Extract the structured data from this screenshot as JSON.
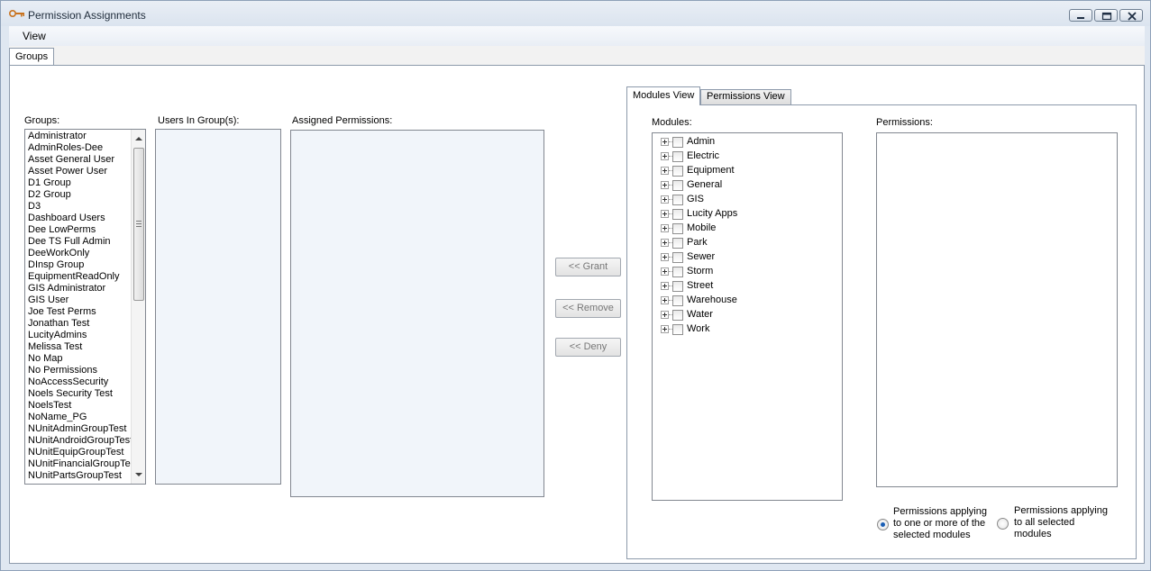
{
  "window": {
    "title": "Permission Assignments",
    "icon": "key-icon"
  },
  "menu": {
    "view_label": "View"
  },
  "tabs": [
    {
      "label": "Groups",
      "selected": true
    }
  ],
  "groups_panel": {
    "label": "Groups:",
    "items": [
      "Administrator",
      "AdminRoles-Dee",
      "Asset General User",
      "Asset Power User",
      "D1 Group",
      "D2 Group",
      "D3",
      "Dashboard Users",
      "Dee LowPerms",
      "Dee TS Full Admin",
      "DeeWorkOnly",
      "DInsp Group",
      "EquipmentReadOnly",
      "GIS Administrator",
      "GIS User",
      "Joe Test Perms",
      "Jonathan Test",
      "LucityAdmins",
      "Melissa Test",
      "No Map",
      "No Permissions",
      "NoAccessSecurity",
      "Noels Security Test",
      "NoelsTest",
      "NoName_PG",
      "NUnitAdminGroupTest",
      "NUnitAndroidGroupTest",
      "NUnitEquipGroupTest",
      "NUnitFinancialGroupTest",
      "NUnitPartsGroupTest"
    ]
  },
  "users_panel": {
    "label": "Users In Group(s):"
  },
  "assigned_panel": {
    "label": "Assigned Permissions:"
  },
  "actions": {
    "grant_label": "<< Grant",
    "remove_label": "<< Remove",
    "deny_label": "<< Deny"
  },
  "view_tabs": [
    {
      "label": "Modules View",
      "selected": true
    },
    {
      "label": "Permissions View",
      "selected": false
    }
  ],
  "modules_panel": {
    "label": "Modules:",
    "items": [
      "Admin",
      "Electric",
      "Equipment",
      "General",
      "GIS",
      "Lucity Apps",
      "Mobile",
      "Park",
      "Sewer",
      "Storm",
      "Street",
      "Warehouse",
      "Water",
      "Work"
    ]
  },
  "permissions_panel": {
    "label": "Permissions:"
  },
  "filter_options": {
    "one_or_more_label": "Permissions applying to one or more of the selected modules",
    "all_selected_label": "Permissions applying to all selected modules",
    "selected": "one_or_more"
  }
}
